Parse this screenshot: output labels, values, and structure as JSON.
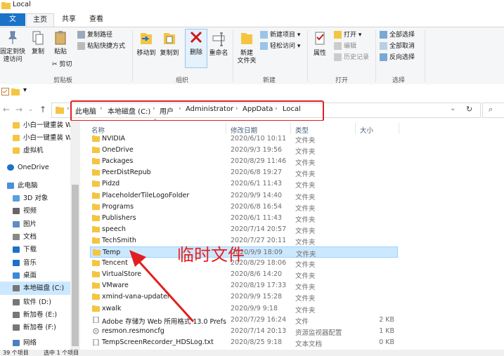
{
  "window": {
    "title": "Local"
  },
  "tabs": [
    "文件",
    "主页",
    "共享",
    "查看"
  ],
  "ribbon": {
    "clipboard": {
      "pin": "固定到快\n速访问",
      "copy": "复制",
      "paste": "粘贴",
      "copy_path": "复制路径",
      "paste_shortcut": "粘贴快捷方式",
      "cut": "剪切",
      "label": "剪贴板"
    },
    "organize": {
      "move_to": "移动到",
      "copy_to": "复制到",
      "delete": "删除",
      "rename": "重命名",
      "label": "组织"
    },
    "new": {
      "new_folder": "新建\n文件夹",
      "new_item": "新建项目 ▾",
      "easy_access": "轻松访问 ▾",
      "label": "新建"
    },
    "open": {
      "properties": "属性",
      "open": "打开 ▾",
      "edit": "编辑",
      "history": "历史记录",
      "label": "打开"
    },
    "select": {
      "select_all": "全部选择",
      "select_none": "全部取消",
      "invert": "反向选择",
      "label": "选择"
    }
  },
  "breadcrumb": [
    "此电脑",
    "本地磁盘 (C:)",
    "用户",
    "Administrator",
    "AppData",
    "Local"
  ],
  "nav_pane": {
    "items": [
      {
        "label": "小白一键重装 W",
        "icon": "folder-icon"
      },
      {
        "label": "小白一键重装 W",
        "icon": "folder-icon"
      },
      {
        "label": "虚拟机",
        "icon": "folder-icon"
      },
      {
        "label": "OneDrive",
        "icon": "cloud-icon"
      },
      {
        "label": "此电脑",
        "icon": "computer-icon"
      },
      {
        "label": "3D 对象",
        "icon": "cube-icon"
      },
      {
        "label": "视频",
        "icon": "video-icon"
      },
      {
        "label": "图片",
        "icon": "pictures-icon"
      },
      {
        "label": "文档",
        "icon": "document-icon"
      },
      {
        "label": "下载",
        "icon": "download-icon"
      },
      {
        "label": "音乐",
        "icon": "music-icon"
      },
      {
        "label": "桌面",
        "icon": "desktop-icon"
      },
      {
        "label": "本地磁盘 (C:)",
        "icon": "drive-icon"
      },
      {
        "label": "软件 (D:)",
        "icon": "drive-icon"
      },
      {
        "label": "新加卷 (E:)",
        "icon": "drive-icon"
      },
      {
        "label": "新加卷 (F:)",
        "icon": "drive-icon"
      },
      {
        "label": "网络",
        "icon": "network-icon"
      }
    ]
  },
  "columns": {
    "name": "名称",
    "date": "修改日期",
    "type": "类型",
    "size": "大小"
  },
  "files": [
    {
      "name": "NVIDIA",
      "date": "2020/6/10 10:11",
      "type": "文件夹",
      "size": "",
      "kind": "folder"
    },
    {
      "name": "OneDrive",
      "date": "2020/9/3 19:56",
      "type": "文件夹",
      "size": "",
      "kind": "folder"
    },
    {
      "name": "Packages",
      "date": "2020/8/29 11:46",
      "type": "文件夹",
      "size": "",
      "kind": "folder"
    },
    {
      "name": "PeerDistRepub",
      "date": "2020/6/8 19:27",
      "type": "文件夹",
      "size": "",
      "kind": "folder"
    },
    {
      "name": "Pidzd",
      "date": "2020/6/1 11:43",
      "type": "文件夹",
      "size": "",
      "kind": "folder"
    },
    {
      "name": "PlaceholderTileLogoFolder",
      "date": "2020/9/9 14:40",
      "type": "文件夹",
      "size": "",
      "kind": "folder"
    },
    {
      "name": "Programs",
      "date": "2020/6/8 16:54",
      "type": "文件夹",
      "size": "",
      "kind": "folder"
    },
    {
      "name": "Publishers",
      "date": "2020/6/1 11:43",
      "type": "文件夹",
      "size": "",
      "kind": "folder"
    },
    {
      "name": "speech",
      "date": "2020/7/14 20:57",
      "type": "文件夹",
      "size": "",
      "kind": "folder"
    },
    {
      "name": "TechSmith",
      "date": "2020/7/27 20:11",
      "type": "文件夹",
      "size": "",
      "kind": "folder"
    },
    {
      "name": "Temp",
      "date": "2020/9/9 18:09",
      "type": "文件夹",
      "size": "",
      "kind": "folder",
      "selected": true
    },
    {
      "name": "Tencent",
      "date": "2020/8/29 18:06",
      "type": "文件夹",
      "size": "",
      "kind": "folder"
    },
    {
      "name": "VirtualStore",
      "date": "2020/8/6 14:20",
      "type": "文件夹",
      "size": "",
      "kind": "folder"
    },
    {
      "name": "VMware",
      "date": "2020/8/19 17:33",
      "type": "文件夹",
      "size": "",
      "kind": "folder"
    },
    {
      "name": "xmind-vana-updater",
      "date": "2020/9/9 15:28",
      "type": "文件夹",
      "size": "",
      "kind": "folder"
    },
    {
      "name": "xwalk",
      "date": "2020/9/9 9:18",
      "type": "文件夹",
      "size": "",
      "kind": "folder"
    },
    {
      "name": "Adobe 存储为 Web 所用格式 13.0 Prefs",
      "date": "2020/7/29 16:24",
      "type": "文件",
      "size": "2 KB",
      "kind": "file"
    },
    {
      "name": "resmon.resmoncfg",
      "date": "2020/7/14 20:13",
      "type": "资源监视器配置",
      "size": "1 KB",
      "kind": "config"
    },
    {
      "name": "TempScreenRecorder_HDSLog.txt",
      "date": "2020/8/25 9:18",
      "type": "文本文档",
      "size": "0 KB",
      "kind": "text"
    }
  ],
  "status": {
    "count": "39 个项目",
    "selected": "选中 1 个项目"
  },
  "annotation": {
    "text": "临时文件",
    "color": "#e62020"
  },
  "colors": {
    "accent": "#1a73c9",
    "selection": "#cce8ff",
    "folder": "#f5c542",
    "annotation": "#e02020"
  }
}
